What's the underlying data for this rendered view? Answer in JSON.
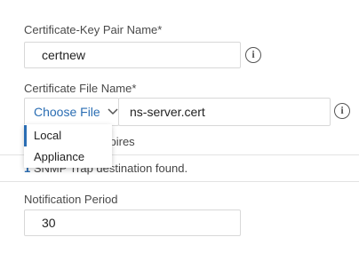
{
  "form": {
    "cert_key_pair": {
      "label": "Certificate-Key Pair Name*",
      "value": "certnew"
    },
    "cert_file": {
      "label": "Certificate File Name*",
      "choose_label": "Choose File",
      "value": "ns-server.cert"
    },
    "choose_menu": {
      "options": [
        "Local",
        "Appliance"
      ],
      "selected": "Local"
    },
    "expires_fragment": "xpires",
    "snmp": {
      "count": "1",
      "text": "SNMP Trap destination found."
    },
    "notification": {
      "label": "Notification Period",
      "value": "30"
    }
  },
  "icons": [
    "info-icon",
    "chevron-down-icon"
  ],
  "colors": {
    "accent": "#2a6db3",
    "border": "#d8d8d8",
    "text": "#333333"
  }
}
